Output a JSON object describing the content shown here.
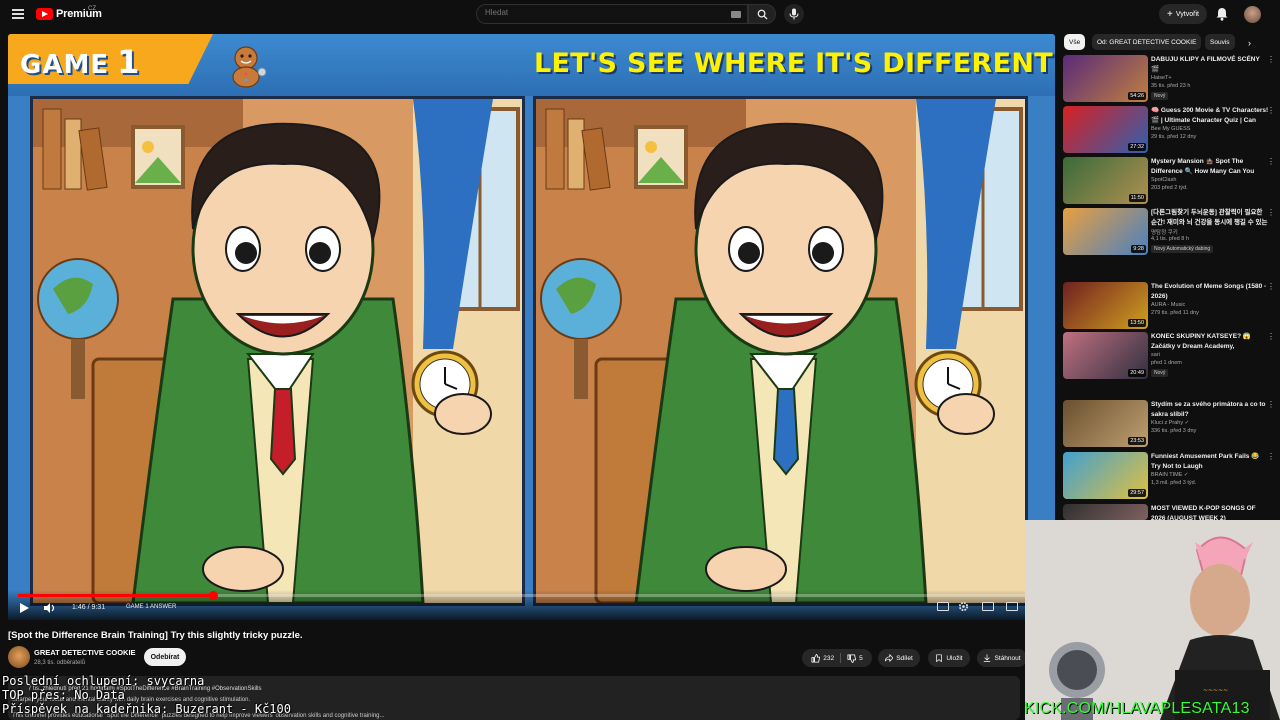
{
  "topbar": {
    "logo_text": "Premium",
    "logo_country": "CZ",
    "search_placeholder": "Hledat",
    "create_label": "Vytvořit"
  },
  "video": {
    "header_game": "GAME",
    "header_num": "1",
    "headline": "LET'S SEE WHERE IT'S DIFFERENT",
    "time": "1:46 / 9:31",
    "chapter": "GAME 1 ANSWER",
    "progress": 0.19
  },
  "meta": {
    "title": "[Spot the Difference Brain Training] Try this slightly tricky puzzle.",
    "channel": "GREAT DETECTIVE COOKIE",
    "subscribers": "28,3 tis. odběratelů",
    "subscribe_label": "Odebírat",
    "likes": "232",
    "dislikes": "5",
    "share_label": "Sdílet",
    "save_label": "Uložit",
    "download_label": "Stáhnout",
    "desc_meta": "7 tis. zhlédnutí  před 21 hodinami  #SpotTheDifference #BrainTraining #ObservationSkills",
    "desc_line1": "Sharpen your focus and mental clarity with daily brain exercises and cognitive stimulation.",
    "desc_line2": "This channel provides educational \"Spot the Difference\" puzzles designed to help improve viewers' observation skills and cognitive training..."
  },
  "overlay": {
    "line1": "Poslední ochlupení: svycarna",
    "line2": "TOP přes: No Data",
    "line3": "Příspěvek na kadeřnika: Buzerant - Kč100",
    "kick": "KICK.COM/HLAVAPLESATA13"
  },
  "sidebar": {
    "chips": [
      "Vše",
      "Od: GREAT DETECTIVE COOKIE",
      "Souvis"
    ],
    "recs": [
      {
        "title": "DABUJU KLIPY A FILMOVÉ SCÉNY 🎬",
        "channel": "HaiseT+",
        "stats": "35 tis.  před 23 h",
        "badge": "Nový",
        "dur": "54:26",
        "c1": "#5a2a7a",
        "c2": "#c08040"
      },
      {
        "title": "🧠 Guess 200 Movie & TV Characters! 🎬 | Ultimate Character Quiz | Can You Name Them All?",
        "channel": "Bee My GUESS",
        "stats": "29 tis.  před 12 dny",
        "badge": "",
        "dur": "27:32",
        "c1": "#d82020",
        "c2": "#3060b0"
      },
      {
        "title": "Mystery Mansion 🏚️ Spot The Difference 🔍 How Many Can You Find?",
        "channel": "SpotClash",
        "stats": "203  před 2 týd.",
        "badge": "",
        "dur": "11:50",
        "c1": "#3a6a3a",
        "c2": "#b09050"
      },
      {
        "title": "[다른그림찾기 두뇌운동] 관찰력이 필요한 순간! 재미와 뇌 건강을 동시에 챙길 수 있는 똑똑한 습관을 길...",
        "channel": "명탐정 쿠키",
        "stats": "4,1 tis.  před 8 h",
        "badge": "Nový  Automatický dabing",
        "dur": "9:28",
        "c1": "#e8a040",
        "c2": "#4a80c0"
      },
      {
        "title": "The Evolution of Meme Songs (1580 - 2026)",
        "channel": "AURA - Music",
        "stats": "279 tis.  před 11 dny",
        "badge": "",
        "dur": "13:50",
        "c1": "#702020",
        "c2": "#d0a020"
      },
      {
        "title": "KONEC SKUPINY KATSEYE? 😱 Začátky v Dream Academy, Kontroverzní tyč, Proč jsou jen 4?",
        "channel": "sari",
        "stats": "před 1 dnem",
        "badge": "Nový",
        "dur": "20:49",
        "c1": "#c07080",
        "c2": "#303040"
      },
      {
        "title": "Stydím se za svého primátora a co to sakra slíbil?",
        "channel": "Kluci z Prahy ✓",
        "stats": "336 tis.  před 3 dny",
        "badge": "",
        "dur": "23:53",
        "c1": "#6a5030",
        "c2": "#c0a070"
      },
      {
        "title": "Funniest Amusement Park Fails 😂 Try Not to Laugh",
        "channel": "BRAIN TIME ✓",
        "stats": "1,3 mil.  před 3 týd.",
        "badge": "",
        "dur": "29:57",
        "c1": "#40a0d0",
        "c2": "#e0c040"
      },
      {
        "title": "MOST VIEWED K-POP SONGS OF 2026 (AUGUST WEEK 2)",
        "channel": "",
        "stats": "",
        "badge": "",
        "dur": "",
        "c1": "#303030",
        "c2": "#806060"
      }
    ]
  },
  "colors": {
    "accent_red": "#ff0000",
    "headline_yellow": "#fff200",
    "game_tag": "#f7a81d",
    "kick_green": "#32ff32"
  }
}
